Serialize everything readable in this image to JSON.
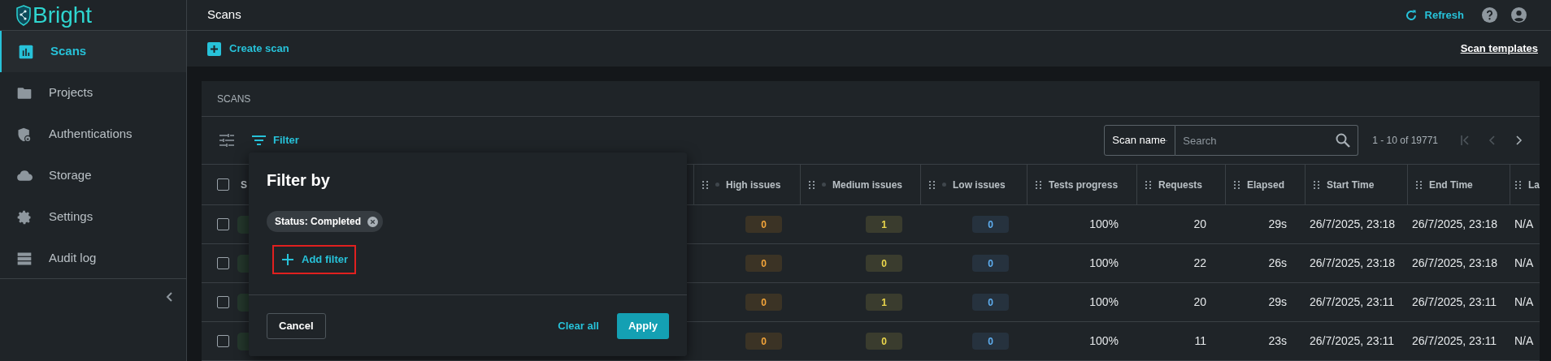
{
  "logo": {
    "text": "Bright"
  },
  "sidebar": {
    "items": [
      {
        "label": "Scans",
        "selected": true
      },
      {
        "label": "Projects",
        "selected": false
      },
      {
        "label": "Authentications",
        "selected": false
      },
      {
        "label": "Storage",
        "selected": false
      },
      {
        "label": "Settings",
        "selected": false
      },
      {
        "label": "Audit log",
        "selected": false
      }
    ]
  },
  "header": {
    "title": "Scans",
    "refresh": "Refresh"
  },
  "toolbar": {
    "create": "Create scan",
    "templates": "Scan templates"
  },
  "card": {
    "title": "SCANS",
    "filter": "Filter",
    "search_by": "Scan name",
    "search_placeholder": "Search",
    "pagination": "1 - 10 of 19771",
    "pager": [
      {
        "kind": "first",
        "disabled": true
      },
      {
        "kind": "prev",
        "disabled": true
      },
      {
        "kind": "next",
        "disabled": false
      }
    ]
  },
  "table": {
    "header_checked": false,
    "columns": [
      {
        "label": "S",
        "kind": "plain"
      },
      {
        "label": "High issues",
        "kind": "severity"
      },
      {
        "label": "Medium issues",
        "kind": "severity"
      },
      {
        "label": "Low issues",
        "kind": "severity"
      },
      {
        "label": "Tests progress",
        "kind": "plain"
      },
      {
        "label": "Requests",
        "kind": "plain"
      },
      {
        "label": "Elapsed",
        "kind": "plain"
      },
      {
        "label": "Start Time",
        "kind": "plain"
      },
      {
        "label": "End Time",
        "kind": "plain"
      },
      {
        "label": "La",
        "kind": "plain"
      }
    ],
    "rows": [
      {
        "checked": false,
        "high": "0",
        "medium": "1",
        "low": "0",
        "progress": "100%",
        "requests": "20",
        "elapsed": "29s",
        "start": "26/7/2025, 23:18",
        "end": "26/7/2025, 23:18",
        "last": "N/A"
      },
      {
        "checked": false,
        "high": "0",
        "medium": "0",
        "low": "0",
        "progress": "100%",
        "requests": "22",
        "elapsed": "26s",
        "start": "26/7/2025, 23:18",
        "end": "26/7/2025, 23:18",
        "last": "N/A"
      },
      {
        "checked": false,
        "high": "0",
        "medium": "1",
        "low": "0",
        "progress": "100%",
        "requests": "20",
        "elapsed": "29s",
        "start": "26/7/2025, 23:11",
        "end": "26/7/2025, 23:11",
        "last": "N/A"
      },
      {
        "checked": false,
        "high": "0",
        "medium": "0",
        "low": "0",
        "progress": "100%",
        "requests": "11",
        "elapsed": "23s",
        "start": "26/7/2025, 23:11",
        "end": "26/7/2025, 23:11",
        "last": "N/A"
      }
    ]
  },
  "filter_popup": {
    "title": "Filter by",
    "chips": [
      {
        "label": "Status: Completed"
      }
    ],
    "add": "Add filter",
    "add_highlighted": true,
    "cancel": "Cancel",
    "clear": "Clear all",
    "apply": "Apply"
  }
}
